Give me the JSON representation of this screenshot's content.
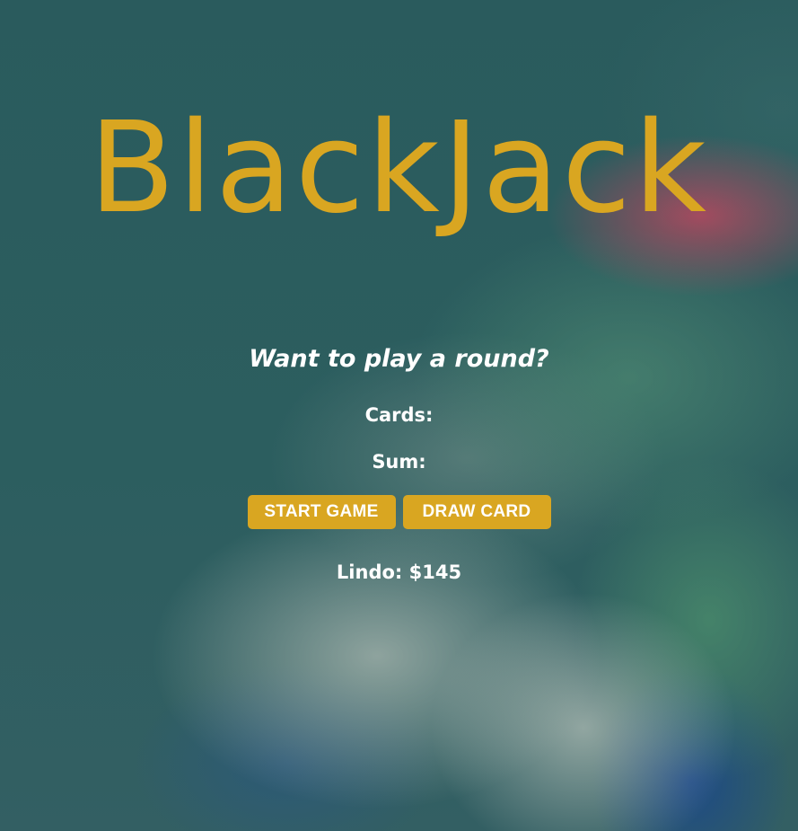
{
  "game": {
    "title": "BlackJack",
    "message": "Want to play a round?",
    "cards_label": "Cards:",
    "sum_label": "Sum:",
    "player_label": "Lindo: $145"
  },
  "buttons": {
    "start_label": "START GAME",
    "draw_label": "DRAW CARD"
  },
  "colors": {
    "accent": "#d9a621",
    "text": "#ffffff",
    "background": "#2c5b5c"
  }
}
